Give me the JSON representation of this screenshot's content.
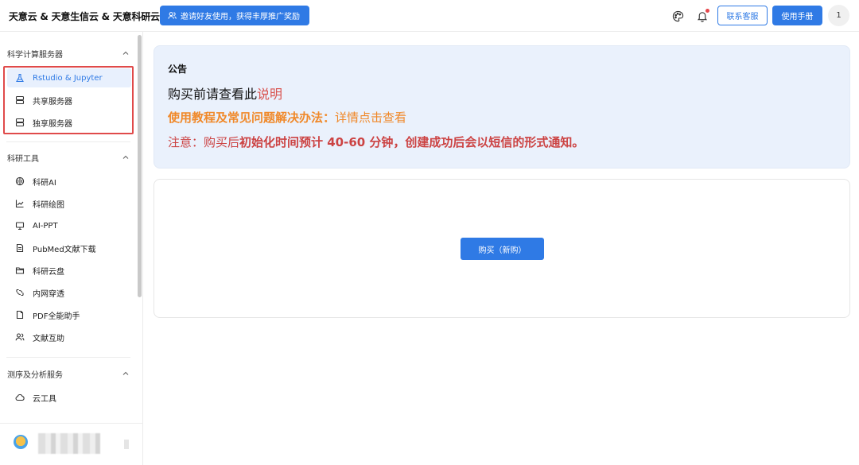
{
  "header": {
    "brand": "天意云 & 天意生信云 & 天意科研云",
    "invite_label": "邀请好友使用，获得丰厚推广奖励",
    "contact_label": "联系客服",
    "manual_label": "使用手册",
    "avatar_text": "1"
  },
  "sidebar": {
    "groups": [
      {
        "title": "科学计算服务器",
        "items": [
          {
            "label": "Rstudio & Jupyter",
            "icon": "flask-icon",
            "active": true
          },
          {
            "label": "共享服务器",
            "icon": "server-icon"
          },
          {
            "label": "独享服务器",
            "icon": "server-icon"
          }
        ]
      },
      {
        "title": "科研工具",
        "items": [
          {
            "label": "科研AI",
            "icon": "brain-icon"
          },
          {
            "label": "科研绘图",
            "icon": "line-chart-icon"
          },
          {
            "label": "AI-PPT",
            "icon": "presentation-icon"
          },
          {
            "label": "PubMed文献下载",
            "icon": "document-icon"
          },
          {
            "label": "科研云盘",
            "icon": "folder-icon"
          },
          {
            "label": "内网穿透",
            "icon": "network-icon"
          },
          {
            "label": "PDF全能助手",
            "icon": "file-icon"
          },
          {
            "label": "文献互助",
            "icon": "users-icon"
          }
        ]
      },
      {
        "title": "测序及分析服务",
        "items": [
          {
            "label": "云工具",
            "icon": "cloud-icon"
          }
        ]
      }
    ]
  },
  "notice": {
    "title": "公告",
    "line1_prefix": "购买前请查看此",
    "line1_link": "说明",
    "line2_bold": "使用教程及常见问题解决办法：",
    "line2_rest": "详情点击查看",
    "line3_prefix": "注意：购买后",
    "line3_bold": "初始化时间预计 40-60 分钟，创建成功后会以短信的形式通知。"
  },
  "buy": {
    "label": "购买（新购）"
  },
  "colors": {
    "primary": "#2f7ae5",
    "notice_bg": "#eaf1fc",
    "accent_orange": "#f0892a",
    "accent_red": "#cc4343",
    "highlight_red": "#e04a4a"
  }
}
